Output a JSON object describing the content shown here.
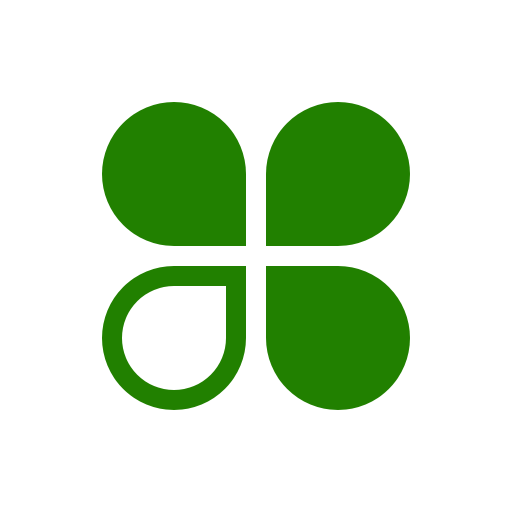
{
  "colors": {
    "background": "#ffffff",
    "brand_green": "#218000"
  },
  "logo": {
    "icon": "four-leaf-clover-icon",
    "leaves": [
      {
        "name": "top-left",
        "style": "filled"
      },
      {
        "name": "top-right",
        "style": "filled"
      },
      {
        "name": "bottom-left",
        "style": "outlined"
      },
      {
        "name": "bottom-right",
        "style": "filled"
      }
    ]
  }
}
